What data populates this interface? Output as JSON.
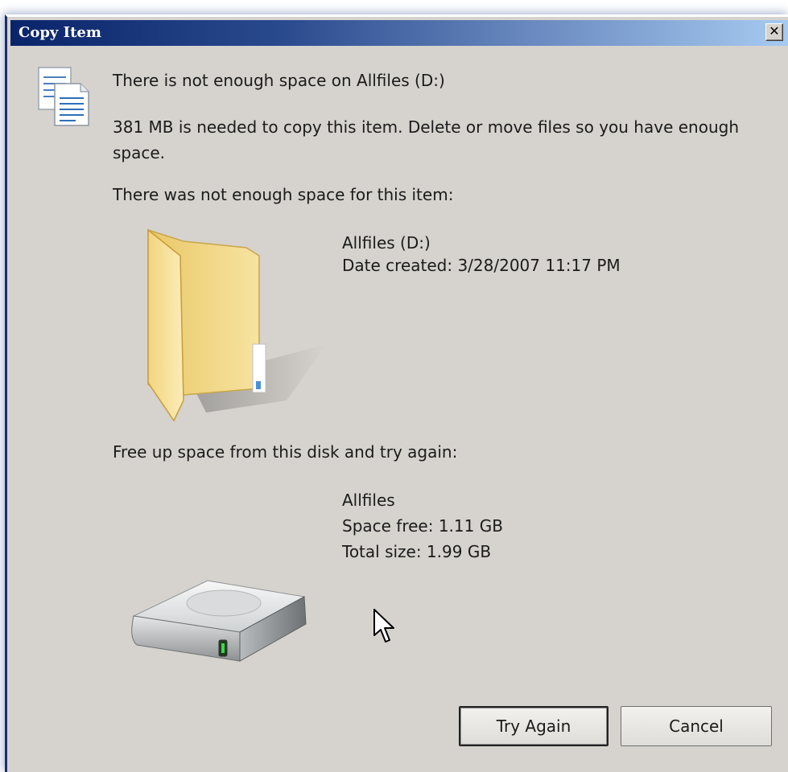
{
  "window": {
    "title": "Copy Item",
    "close_label": "✕"
  },
  "message": {
    "heading": "There is not enough space on Allfiles (D:)",
    "detail": "381 MB is needed to copy this item. Delete or move files so you have enough space.",
    "section_item": "There was not enough space for this item:",
    "section_disk": "Free up space from this disk and try again:"
  },
  "item": {
    "name": "Allfiles (D:)",
    "date_created": "Date created: 3/28/2007 11:17 PM",
    "icon": "folder-icon"
  },
  "disk": {
    "name": "Allfiles",
    "space_free": "Space free: 1.11 GB",
    "total_size": "Total size: 1.99 GB",
    "icon": "hard-drive-icon"
  },
  "buttons": {
    "try_again": "Try Again",
    "cancel": "Cancel"
  },
  "icons": {
    "dialog": "copy-documents-icon",
    "cursor": "mouse-pointer-icon"
  },
  "colors": {
    "title_gradient_start": "#0a246a",
    "title_gradient_end": "#a6caf0",
    "dialog_background": "#d6d3ce"
  }
}
